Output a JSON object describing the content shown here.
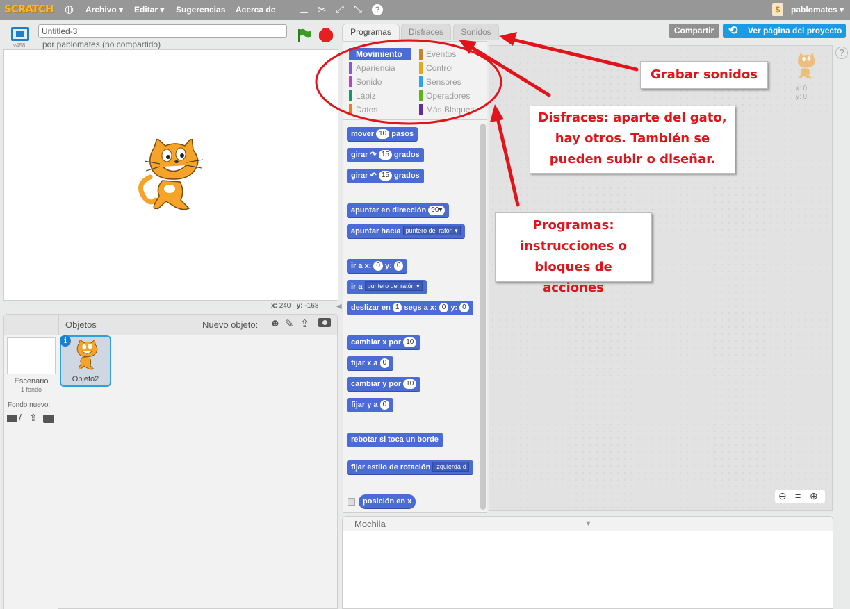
{
  "topbar": {
    "logo": "SCRATCH",
    "menu": [
      "Archivo ▾",
      "Editar ▾",
      "Sugerencias",
      "Acerca de"
    ],
    "user": "pablomates ▾"
  },
  "stage": {
    "version": "v458",
    "project_title": "Untitled-3",
    "author": "por pablomates (no compartido)",
    "coords_x_label": "x:",
    "coords_x": "240",
    "coords_y_label": "y:",
    "coords_y": "-168"
  },
  "sprites": {
    "header": "Objetos",
    "new_object": "Nuevo objeto:",
    "stage_label": "Escenario",
    "stage_sub": "1 fondo",
    "new_backdrop": "Fondo nuevo:",
    "sprite_name": "Objeto2"
  },
  "tabs": [
    "Programas",
    "Disfraces",
    "Sonidos"
  ],
  "buttons": {
    "share": "Compartir",
    "view_page": "Ver página del proyecto"
  },
  "categories_left": [
    {
      "label": "Movimiento",
      "color": "#4a6cd4"
    },
    {
      "label": "Apariencia",
      "color": "#8a55d7"
    },
    {
      "label": "Sonido",
      "color": "#bb42c3"
    },
    {
      "label": "Lápiz",
      "color": "#0e9a6c"
    },
    {
      "label": "Datos",
      "color": "#ee7d16"
    }
  ],
  "categories_right": [
    {
      "label": "Eventos",
      "color": "#c88330"
    },
    {
      "label": "Control",
      "color": "#e1a91a"
    },
    {
      "label": "Sensores",
      "color": "#2ca5e2"
    },
    {
      "label": "Operadores",
      "color": "#5cb712"
    },
    {
      "label": "Más Bloques",
      "color": "#632d99"
    }
  ],
  "blocks": {
    "mover": [
      "mover",
      "10",
      "pasos"
    ],
    "girar_r": [
      "girar",
      "↷",
      "15",
      "grados"
    ],
    "girar_l": [
      "girar",
      "↶",
      "15",
      "grados"
    ],
    "apuntar_dir": [
      "apuntar en dirección",
      "90▾"
    ],
    "apuntar_hacia": [
      "apuntar hacia",
      "puntero del ratón ▾"
    ],
    "ir_xy": [
      "ir a x:",
      "0",
      "y:",
      "0"
    ],
    "ir_a": [
      "ir a",
      "puntero del ratón ▾"
    ],
    "deslizar": [
      "deslizar en",
      "1",
      "segs a x:",
      "0",
      "y:",
      "0"
    ],
    "cambiar_x": [
      "cambiar x por",
      "10"
    ],
    "fijar_x": [
      "fijar x a",
      "0"
    ],
    "cambiar_y": [
      "cambiar y por",
      "10"
    ],
    "fijar_y": [
      "fijar y a",
      "0"
    ],
    "rebotar": "rebotar si toca un borde",
    "estilo": [
      "fijar estilo de rotación",
      "izquierda-d"
    ],
    "posicion_x": "posición en x"
  },
  "script_area": {
    "sprite_x": "x: 0",
    "sprite_y": "y: 0"
  },
  "backpack": {
    "label": "Mochila",
    "arrow": "▼"
  },
  "callouts": {
    "sonidos": "Grabar sonidos",
    "disfraces": "Disfraces: aparte del gato, hay otros. También se pueden subir o diseñar.",
    "programas": "Programas: instrucciones o bloques de acciones"
  },
  "annotation_color": "#e0141a"
}
